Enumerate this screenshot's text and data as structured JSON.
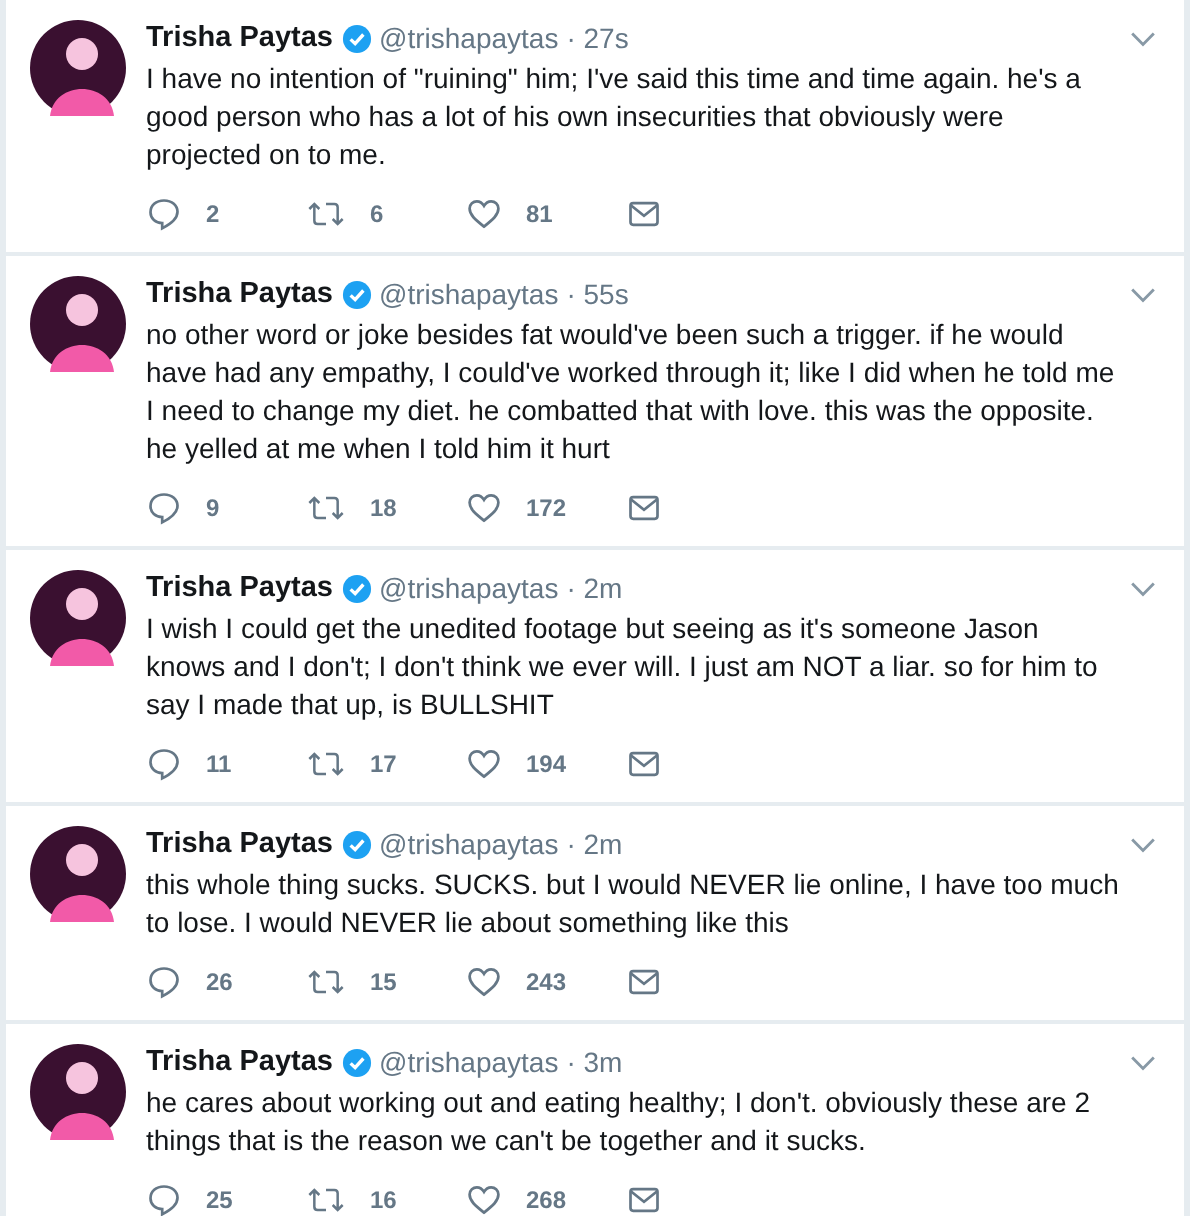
{
  "tweets": [
    {
      "name": "Trisha Paytas",
      "verified": true,
      "handle": "@trishapaytas",
      "time": "· 27s",
      "text": "I have no intention of \"ruining\" him; I've said this time and time again. he's a good person who has a lot of his own insecurities that obviously were projected on to me.",
      "replies": "2",
      "retweets": "6",
      "likes": "81"
    },
    {
      "name": "Trisha Paytas",
      "verified": true,
      "handle": "@trishapaytas",
      "time": "· 55s",
      "text": "no other word or joke besides fat would've been such a trigger. if he would have had any empathy, I could've worked through it; like I did when he told me I need to change my diet. he combatted that with love. this was the opposite. he yelled at me when I told him it hurt",
      "replies": "9",
      "retweets": "18",
      "likes": "172"
    },
    {
      "name": "Trisha Paytas",
      "verified": true,
      "handle": "@trishapaytas",
      "time": "· 2m",
      "text": "I wish I could get the unedited footage but seeing as it's someone Jason knows and I don't; I don't think we ever will. I just am NOT a liar. so for him to say I made that up, is BULLSHIT",
      "replies": "11",
      "retweets": "17",
      "likes": "194"
    },
    {
      "name": "Trisha Paytas",
      "verified": true,
      "handle": "@trishapaytas",
      "time": "· 2m",
      "text": "this whole thing sucks. SUCKS. but I would NEVER lie online, I have too much to lose. I would NEVER lie about something like this",
      "replies": "26",
      "retweets": "15",
      "likes": "243"
    },
    {
      "name": "Trisha Paytas",
      "verified": true,
      "handle": "@trishapaytas",
      "time": "· 3m",
      "text": "he cares about working out and eating healthy; I don't. obviously these are 2 things that is the reason we can't be together and it sucks.",
      "replies": "25",
      "retweets": "16",
      "likes": "268"
    }
  ]
}
